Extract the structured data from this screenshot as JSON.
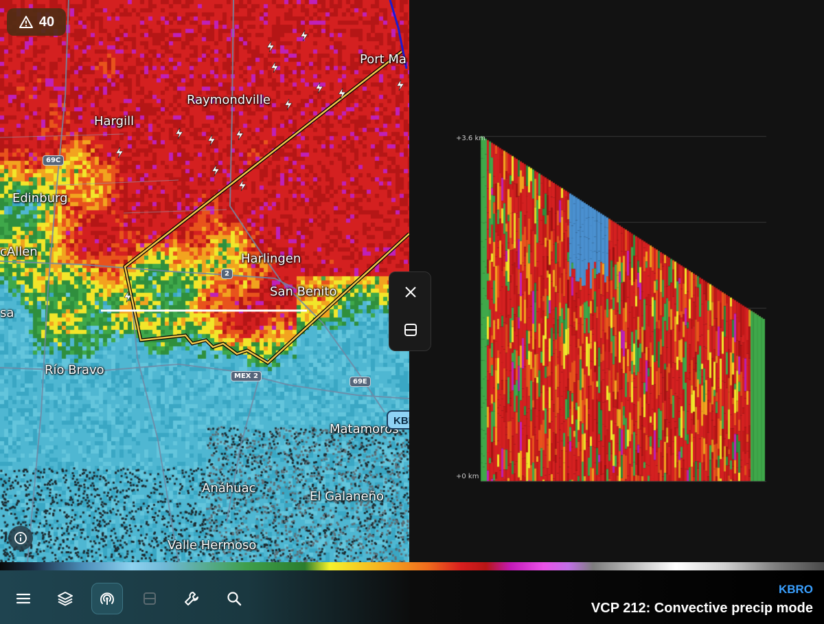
{
  "alert": {
    "count": "40",
    "icon": "warning-triangle-icon"
  },
  "radar_site": {
    "label": "KBR"
  },
  "map": {
    "cities": [
      {
        "name": "Port Ma"
      },
      {
        "name": "Raymondville"
      },
      {
        "name": "Hargill"
      },
      {
        "name": "Edinburg"
      },
      {
        "name": "cAllen"
      },
      {
        "name": "Harlingen"
      },
      {
        "name": "San Benito"
      },
      {
        "name": "sa"
      },
      {
        "name": "Río Bravo"
      },
      {
        "name": "Matamoros"
      },
      {
        "name": "Anáhuac"
      },
      {
        "name": "El Galaneño"
      },
      {
        "name": "Valle Hermoso"
      }
    ],
    "shields": [
      {
        "label": "69C"
      },
      {
        "label": "2"
      },
      {
        "label": "MEX 2"
      },
      {
        "label": "69E"
      }
    ]
  },
  "cross_section": {
    "top_label": "+3.6 km",
    "bottom_label": "+0 km"
  },
  "float_controls": {
    "close_icon": "close-icon",
    "split_icon": "split-view-icon"
  },
  "toolbar": {
    "items": [
      {
        "icon": "menu-icon"
      },
      {
        "icon": "layers-icon"
      },
      {
        "icon": "radar-icon",
        "active": true
      },
      {
        "icon": "split-view-icon",
        "disabled": true
      },
      {
        "icon": "wrench-icon"
      },
      {
        "icon": "search-icon"
      }
    ],
    "station": "KBRO",
    "mode": "VCP 212: Convective precip mode"
  },
  "colors": {
    "station_blue": "#3aa0ff",
    "warning_polygon": "#f2c84b",
    "alert_bg": "#502d14"
  }
}
